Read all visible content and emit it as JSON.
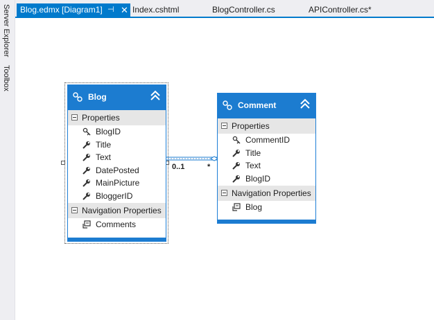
{
  "side_tabs": [
    "Server Explorer",
    "Toolbox"
  ],
  "tabs": [
    {
      "label": "Blog.edmx [Diagram1]",
      "active": true
    },
    {
      "label": "Index.cshtml",
      "active": false
    },
    {
      "label": "BlogController.cs",
      "active": false
    },
    {
      "label": "APIController.cs*",
      "active": false
    }
  ],
  "tab_pin": "⊣",
  "tab_close": "✕",
  "colors": {
    "accent": "#007acc",
    "entity_header": "#1c7cd0",
    "section_bg": "#e6e6e6"
  },
  "entities": {
    "blog": {
      "title": "Blog",
      "properties_label": "Properties",
      "properties": [
        {
          "name": "BlogID",
          "icon": "key-icon"
        },
        {
          "name": "Title",
          "icon": "wrench-icon"
        },
        {
          "name": "Text",
          "icon": "wrench-icon"
        },
        {
          "name": "DatePosted",
          "icon": "wrench-icon"
        },
        {
          "name": "MainPicture",
          "icon": "wrench-icon"
        },
        {
          "name": "BloggerID",
          "icon": "wrench-icon"
        }
      ],
      "nav_label": "Navigation Properties",
      "nav_properties": [
        {
          "name": "Comments",
          "icon": "navigation-icon"
        }
      ]
    },
    "comment": {
      "title": "Comment",
      "properties_label": "Properties",
      "properties": [
        {
          "name": "CommentID",
          "icon": "key-icon"
        },
        {
          "name": "Title",
          "icon": "wrench-icon"
        },
        {
          "name": "Text",
          "icon": "wrench-icon"
        },
        {
          "name": "BlogID",
          "icon": "wrench-icon"
        }
      ],
      "nav_label": "Navigation Properties",
      "nav_properties": [
        {
          "name": "Blog",
          "icon": "navigation-icon"
        }
      ]
    }
  },
  "association": {
    "blog_end": "0..1",
    "comment_end": "*"
  }
}
